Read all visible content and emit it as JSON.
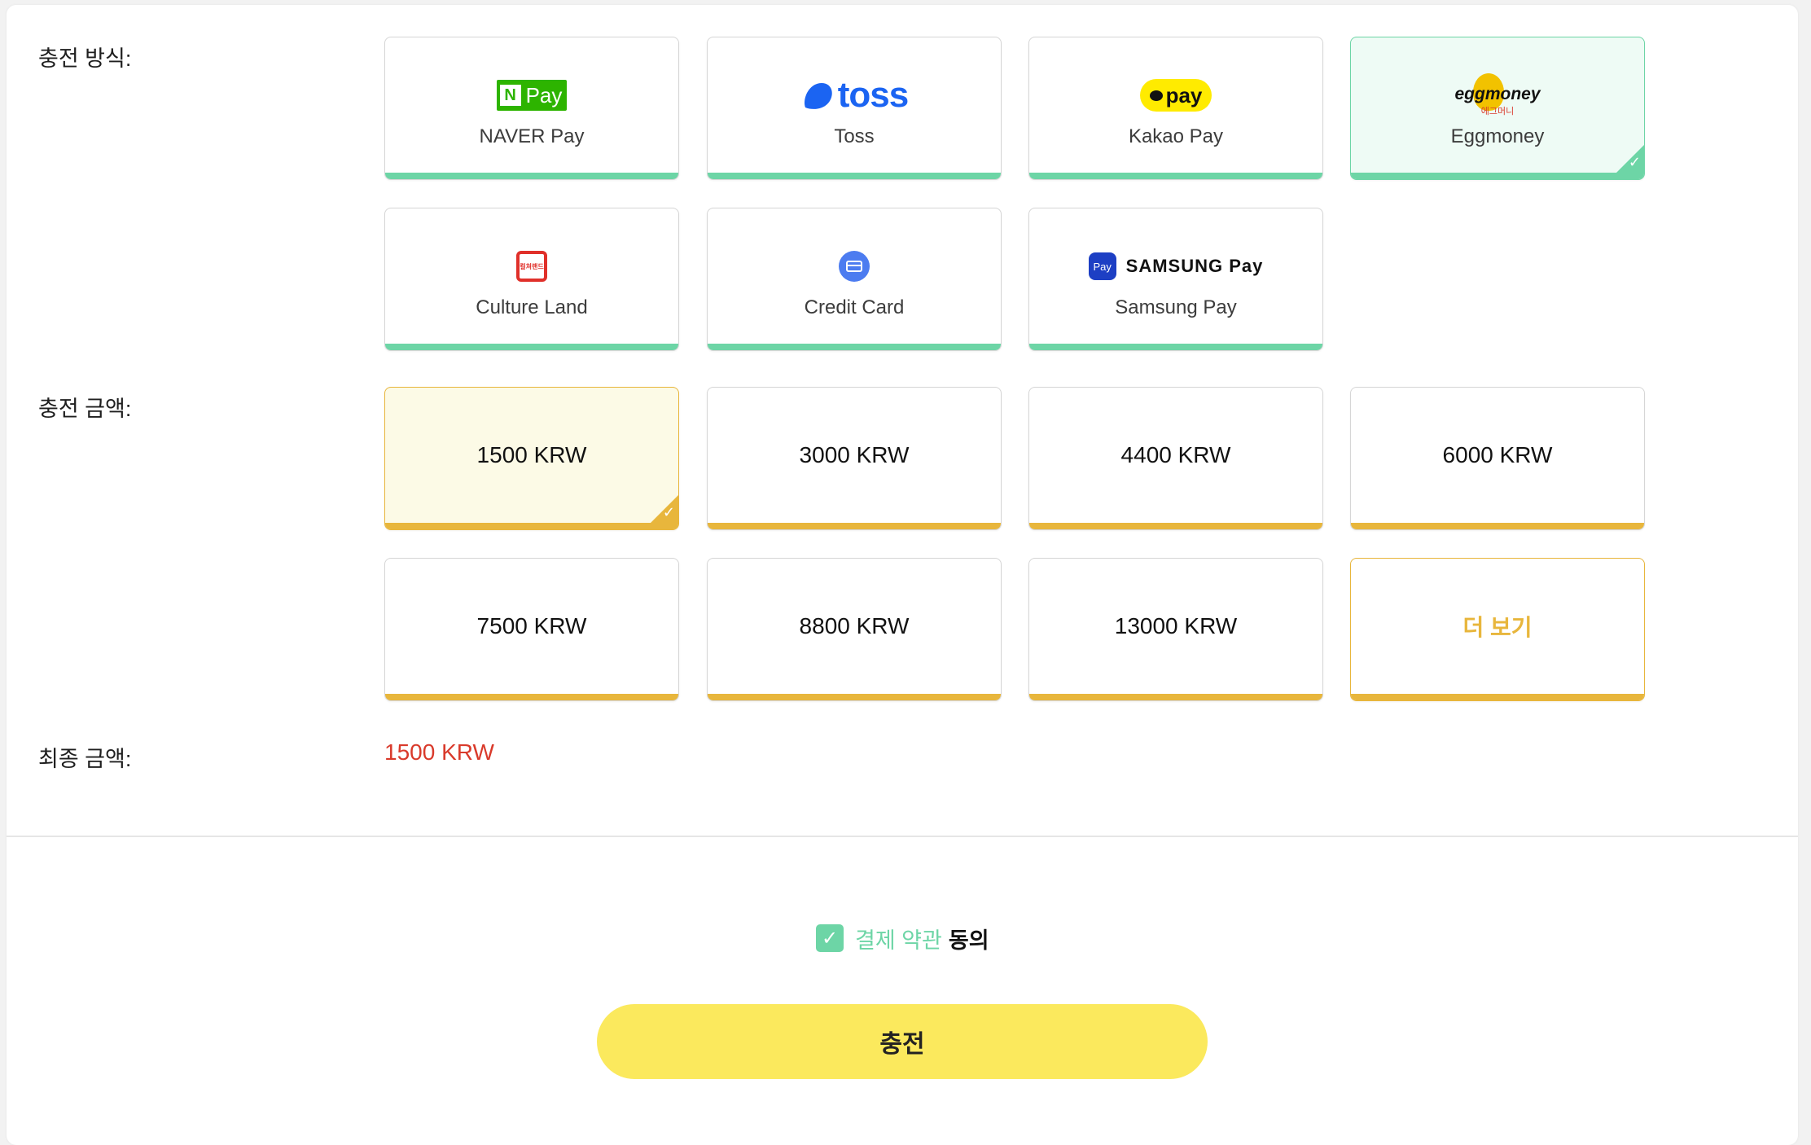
{
  "labels": {
    "method": "충전 방식:",
    "amount": "충전 금액:",
    "final": "최종 금액:"
  },
  "methods": [
    {
      "label": "NAVER Pay",
      "logo_text": "Pay",
      "logo_badge": "N",
      "icon": "naver-pay-logo-icon",
      "selected": false
    },
    {
      "label": "Toss",
      "logo_text": "toss",
      "icon": "toss-logo-icon",
      "selected": false
    },
    {
      "label": "Kakao Pay",
      "logo_text": "pay",
      "icon": "kakao-pay-logo-icon",
      "selected": false
    },
    {
      "label": "Eggmoney",
      "logo_text": "eggmoney",
      "logo_sub": "에그머니",
      "icon": "eggmoney-logo-icon",
      "selected": true
    },
    {
      "label": "Culture Land",
      "logo_text": "컬쳐랜드",
      "icon": "culture-land-logo-icon",
      "selected": false
    },
    {
      "label": "Credit Card",
      "icon": "credit-card-icon",
      "selected": false
    },
    {
      "label": "Samsung Pay",
      "logo_text": "SAMSUNG Pay",
      "logo_badge": "Pay",
      "icon": "samsung-pay-logo-icon",
      "selected": false
    }
  ],
  "amounts": [
    {
      "label": "1500 KRW",
      "selected": true
    },
    {
      "label": "3000 KRW",
      "selected": false
    },
    {
      "label": "4400 KRW",
      "selected": false
    },
    {
      "label": "6000 KRW",
      "selected": false
    },
    {
      "label": "7500 KRW",
      "selected": false
    },
    {
      "label": "8800 KRW",
      "selected": false
    },
    {
      "label": "13000 KRW",
      "selected": false
    }
  ],
  "more_label": "더 보기",
  "final_amount": "1500 KRW",
  "agreement": {
    "checked": true,
    "terms_text": "결제 약관",
    "consent_text": "동의"
  },
  "submit_label": "충전",
  "colors": {
    "green": "#6dd5a6",
    "gold": "#e8b63c",
    "red": "#d93a2b",
    "button": "#fbe95d"
  }
}
